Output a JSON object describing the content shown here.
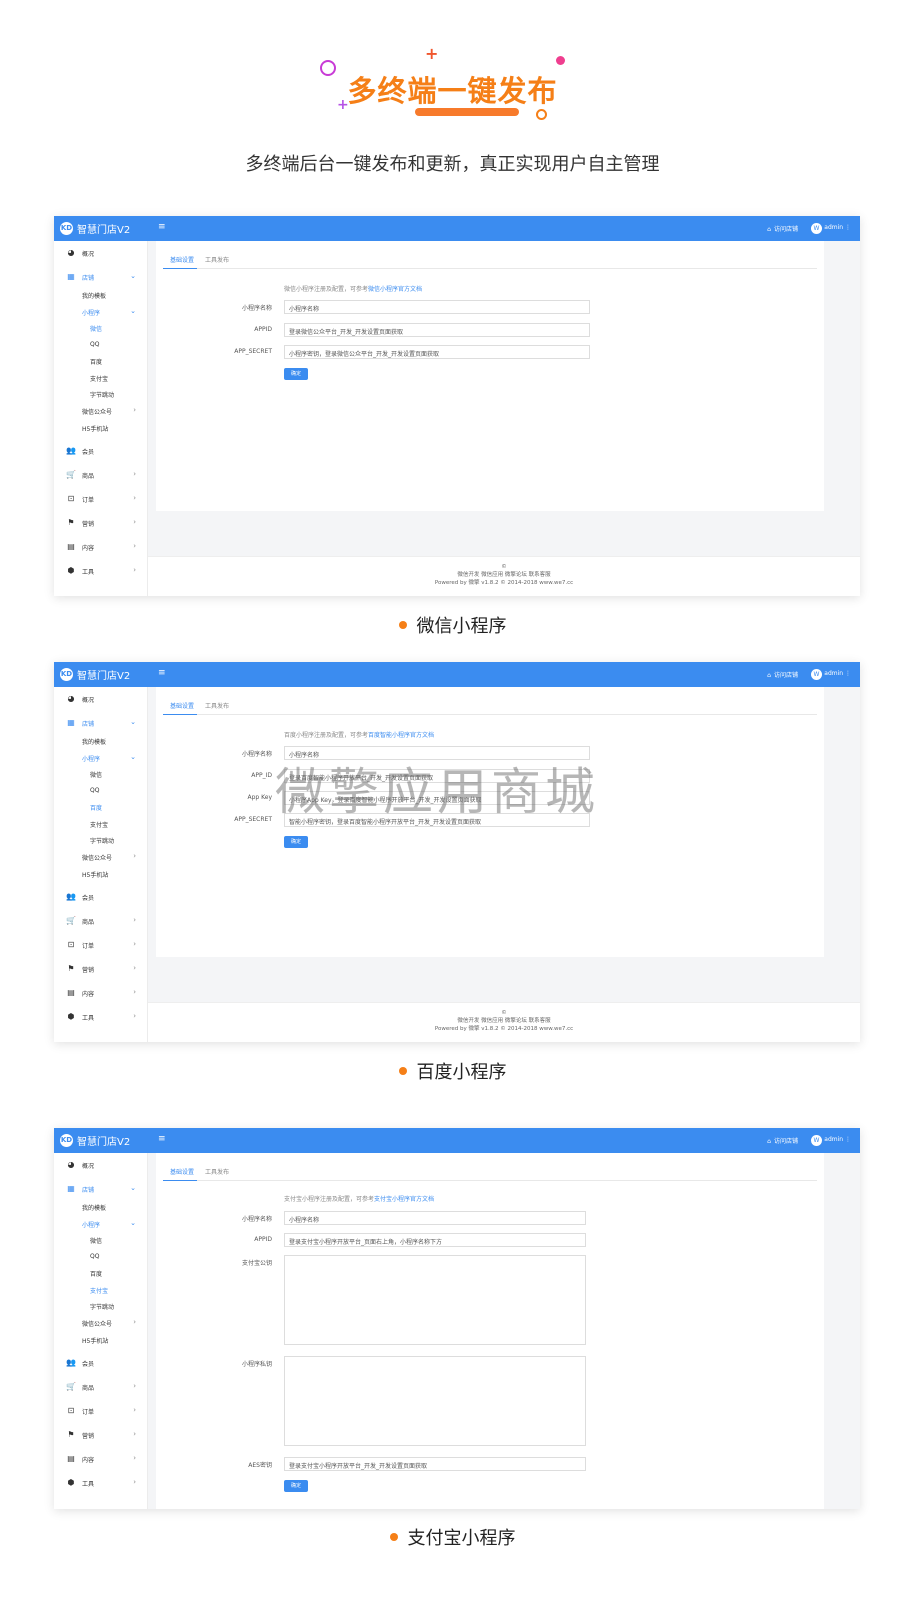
{
  "hero": {
    "title": "多终端一键发布",
    "subtitle": "多终端后台一键发布和更新，真正实现用户自主管理"
  },
  "app": {
    "logo": "KD",
    "brand": "智慧门店V2",
    "menu_icon": "≡",
    "store_link": "访问店铺",
    "avatar": "W",
    "user": "admin",
    "kebab": "⋮"
  },
  "sidebar": {
    "items": [
      {
        "icon": "◕",
        "label": "概况"
      },
      {
        "icon": "▦",
        "label": "店铺"
      },
      {
        "label": "我的模板"
      },
      {
        "label": "小程序"
      },
      {
        "label": "微信"
      },
      {
        "label": "QQ"
      },
      {
        "label": "百度"
      },
      {
        "label": "支付宝"
      },
      {
        "label": "字节跳动"
      },
      {
        "label": "微信公众号"
      },
      {
        "label": "H5手机站"
      },
      {
        "icon": "👥",
        "label": "会员"
      },
      {
        "icon": "🛒",
        "label": "商品"
      },
      {
        "icon": "⊡",
        "label": "订单"
      },
      {
        "icon": "⚑",
        "label": "营销"
      },
      {
        "icon": "▤",
        "label": "内容"
      },
      {
        "icon": "⬢",
        "label": "工具"
      }
    ],
    "arrow_down": "⌄",
    "arrow_right": "›"
  },
  "tabs": {
    "basic": "基础设置",
    "tools": "工具发布"
  },
  "footer": {
    "copy": "©",
    "links": "微信开发 微信应用 微擎论坛 联系客服",
    "powered": "Powered by 微擎 v1.8.2 © 2014-2018 www.we7.cc"
  },
  "wechat": {
    "tip_prefix": "微信小程序注册及配置，可参考",
    "tip_link": "微信小程序官方文档",
    "name_label": "小程序名称",
    "name_placeholder": "小程序名称",
    "appid_label": "APPID",
    "appid_placeholder": "登录微信公众平台_开发_开发设置页面获取",
    "secret_label": "APP_SECRET",
    "secret_placeholder": "小程序密钥，登录微信公众平台_开发_开发设置页面获取",
    "submit": "确定",
    "caption": "微信小程序"
  },
  "baidu": {
    "tip_prefix": "百度小程序注册及配置，可参考",
    "tip_link": "百度智能小程序官方文档",
    "name_label": "小程序名称",
    "name_placeholder": "小程序名称",
    "appid_label": "APP_ID",
    "appid_placeholder": "登录百度智能小程序开放平台_开发_开发设置页面获取",
    "appkey_label": "App Key",
    "appkey_placeholder": "小程序App Key，登录百度智能小程序开放平台_开发_开发设置页面获取",
    "secret_label": "APP_SECRET",
    "secret_placeholder": "智能小程序密钥，登录百度智能小程序开放平台_开发_开发设置页面获取",
    "submit": "确定",
    "caption": "百度小程序",
    "watermark": "微擎应用商城"
  },
  "alipay": {
    "tip_prefix": "支付宝小程序注册及配置，可参考",
    "tip_link": "支付宝小程序官方文档",
    "name_label": "小程序名称",
    "name_placeholder": "小程序名称",
    "appid_label": "APPID",
    "appid_placeholder": "登录支付宝小程序开放平台_页面右上角，小程序名称下方",
    "pubkey_label": "支付宝公钥",
    "privkey_label": "小程序私钥",
    "aes_label": "AES密钥",
    "aes_placeholder": "登录支付宝小程序开放平台_开发_开发设置页面获取",
    "submit": "确定",
    "caption": "支付宝小程序"
  },
  "colors": {
    "primary": "#3b8cf0",
    "accent": "#f57f17"
  }
}
